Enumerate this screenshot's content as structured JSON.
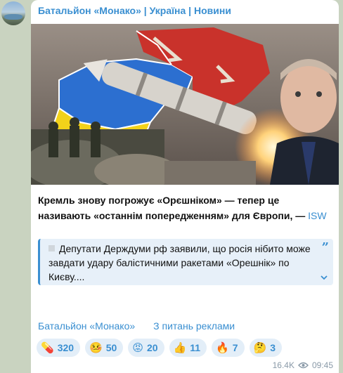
{
  "channel": {
    "name": "Батальйон «Монако» | Україна | Новини"
  },
  "post": {
    "caption_bold": "Кремль знову погрожує «Орєшніком» — тепер це називають «останнім попередженням» для Європи, —",
    "caption_link": "ISW",
    "quote": "Депутати Держдуми рф заявили, що росія нібито може завдати удару балістичними ракетами «Орешнік» по Києву....",
    "link_channel": "Батальйон «Монако»",
    "link_ads": "З питань реклами"
  },
  "reactions": [
    {
      "emoji": "💊",
      "count": "320"
    },
    {
      "emoji": "🤒",
      "count": "50"
    },
    {
      "emoji": "😡",
      "count": "20"
    },
    {
      "emoji": "👍",
      "count": "11"
    },
    {
      "emoji": "🔥",
      "count": "7"
    },
    {
      "emoji": "🤔",
      "count": "3"
    }
  ],
  "meta": {
    "views": "16.4K",
    "time": "09:45"
  },
  "colors": {
    "accent": "#3a8fd1",
    "background": "#c9d3c0",
    "quote_bg": "#e7f0f9"
  },
  "icons": {
    "quote": "quote-icon",
    "expand": "chevron-down-icon",
    "views": "eye-icon"
  }
}
